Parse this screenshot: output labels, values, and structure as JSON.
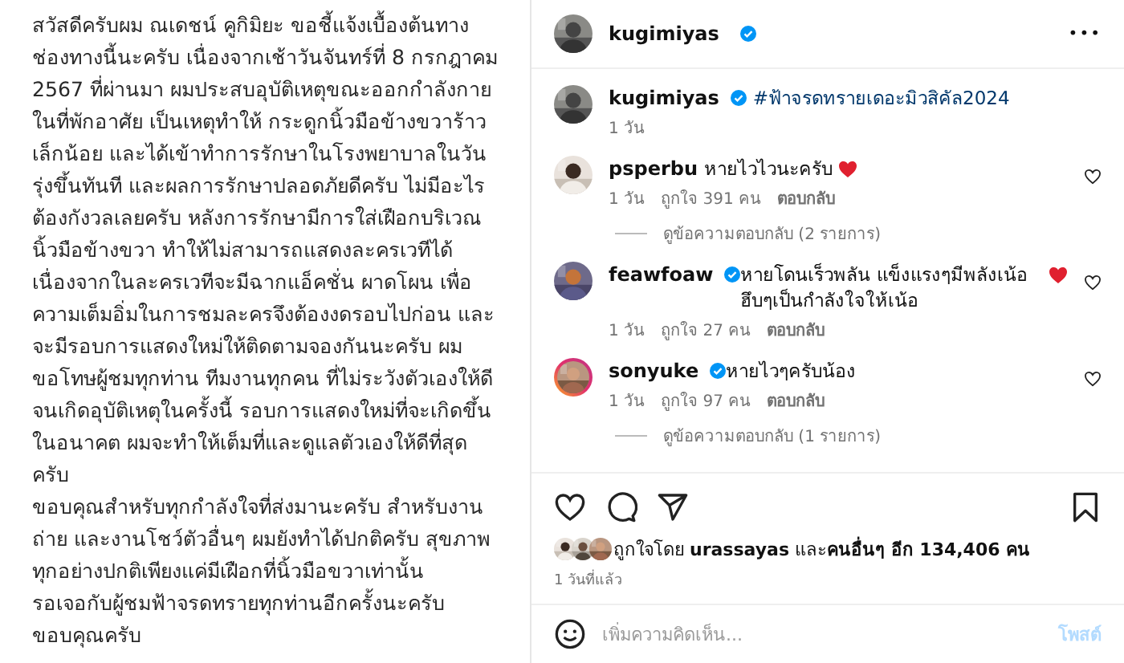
{
  "post_text": {
    "lines": [
      "สวัสดีครับผม ณเดชน์ คูกิมิยะ ขอชี้แจ้งเบื้องต้นทาง",
      "ช่องทางนี้นะครับ เนื่องจากเช้าวันจันทร์ที่ 8 กรกฎาคม",
      "2567 ที่ผ่านมา ผมประสบอุบัติเหตุขณะออกกำลังกาย",
      "ในที่พักอาศัย เป็นเหตุทำให้ กระดูกนิ้วมือข้างขวาร้าว",
      "เล็กน้อย และได้เข้าทำการรักษาในโรงพยาบาลในวัน",
      "รุ่งขึ้นทันที และผลการรักษาปลอดภัยดีครับ ไม่มีอะไร",
      "ต้องกังวลเลยครับ หลังการรักษามีการใส่เฝือกบริเวณ",
      "นิ้วมือข้างขวา ทำให้ไม่สามารถแสดงละครเวทีได้",
      "เนื่องจากในละครเวทีจะมีฉากแอ็คชั่น ผาดโผน เพื่อ",
      "ความเต็มอิ่มในการชมละครจึงต้องงดรอบไปก่อน และ",
      "จะมีรอบการแสดงใหม่ให้ติดตามจองกันนะครับ ผม",
      "ขอโทษผู้ชมทุกท่าน ทีมงานทุกคน ที่ไม่ระวังตัวเองให้ดี",
      "จนเกิดอุบัติเหตุในครั้งนี้ รอบการแสดงใหม่ที่จะเกิดขึ้น",
      "ในอนาคต ผมจะทำให้เต็มที่และดูแลตัวเองให้ดีที่สุด",
      "ครับ",
      "ขอบคุณสำหรับทุกกำลังใจที่ส่งมานะครับ สำหรับงาน",
      "ถ่าย และงานโชว์ตัวอื่นๆ ผมยังทำได้ปกติครับ สุขภาพ",
      "ทุกอย่างปกติเพียงแค่มีเฝือกที่นิ้วมือขวาเท่านั้น",
      "รอเจอกับผู้ชมฟ้าจรดทรายทุกท่านอีกครั้งนะครับ",
      "ขอบคุณครับ"
    ]
  },
  "header": {
    "username": "kugimiyas",
    "verified": true,
    "menu": "•••"
  },
  "caption": {
    "username": "kugimiyas",
    "verified": true,
    "hashtag": "#ฟ้าจรดทรายเดอะมิวสิคัล2024",
    "time": "1 วัน"
  },
  "comments": [
    {
      "username": "psperbu",
      "verified": false,
      "story": false,
      "text": "หายไวไวนะครับ",
      "heart_emoji": true,
      "time": "1 วัน",
      "likes": "ถูกใจ 391 คน",
      "reply": "ตอบกลับ",
      "view_replies": "ดูข้อความตอบกลับ (2 รายการ)"
    },
    {
      "username": "feawfoaw",
      "verified": true,
      "story": false,
      "text": "หายโดนเร็วพลัน แข็งแรงๆมีพลังเน้อ ฮึบๆเป็นกำลังใจให้เน้อ",
      "heart_emoji": true,
      "time": "1 วัน",
      "likes": "ถูกใจ 27 คน",
      "reply": "ตอบกลับ"
    },
    {
      "username": "sonyuke",
      "verified": true,
      "story": true,
      "text": "หายไวๆครับน้อง",
      "heart_emoji": false,
      "time": "1 วัน",
      "likes": "ถูกใจ 97 คน",
      "reply": "ตอบกลับ",
      "view_replies": "ดูข้อความตอบกลับ (1 รายการ)"
    }
  ],
  "likes": {
    "text": "ถูกใจโดย **urassayas** และ**คนอื่นๆ อีก 134,406 คน**",
    "time": "1 วันที่แล้ว"
  },
  "comment_box": {
    "placeholder": "เพิ่มความคิดเห็น...",
    "post_button": "โพสต์",
    "post_disabled": true
  }
}
